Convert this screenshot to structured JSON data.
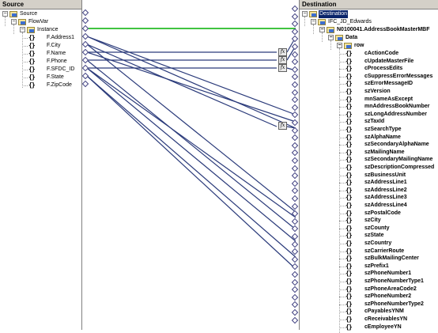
{
  "source": {
    "header": "Source",
    "root": "Source",
    "flowvar": "FlowVar",
    "instance": "Instance",
    "fields": [
      "F.Address1",
      "F.City",
      "F.Name",
      "F.Phone",
      "F.SFDC_ID",
      "F.State",
      "F.ZipCode"
    ]
  },
  "destination": {
    "header": "Destination",
    "root": "Destination",
    "service": "IFC_JD_Edwards",
    "message": "N0100041.AddressBookMasterMBF",
    "data": "Data",
    "row": "row",
    "fields": [
      "cActionCode",
      "cUpdateMasterFile",
      "cProcessEdits",
      "cSuppressErrorMessages",
      "szErrorMessageID",
      "szVersion",
      "mnSameAsExcept",
      "mnAddressBookNumber",
      "szLongAddressNumber",
      "szTaxId",
      "szSearchType",
      "szAlphaName",
      "szSecondaryAlphaName",
      "szMailingName",
      "szSecondaryMailingName",
      "szDescriptionCompressed",
      "szBusinessUnit",
      "szAddressLine1",
      "szAddressLine2",
      "szAddressLine3",
      "szAddressLine4",
      "szPostalCode",
      "szCity",
      "szCounty",
      "szState",
      "szCountry",
      "szCarrierRoute",
      "szBulkMailingCenter",
      "szPrefix1",
      "szPhoneNumber1",
      "szPhoneNumberType1",
      "szPhoneAreaCode2",
      "szPhoneNumber2",
      "szPhoneNumberType2",
      "cPayablesYNM",
      "cReceivablesYN",
      "cEmployeeYN"
    ]
  },
  "function_label": "fx",
  "colors": {
    "wire": "#2a3a7a",
    "highlight_wire": "#00b000",
    "selection": "#0a246a"
  }
}
